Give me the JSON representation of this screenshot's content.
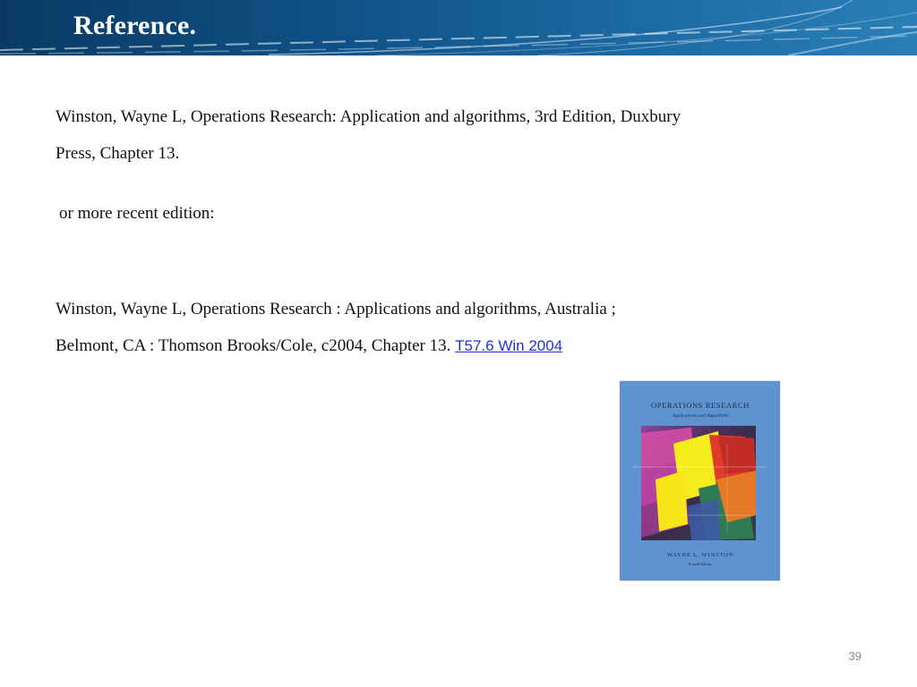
{
  "slide": {
    "title": "Reference.",
    "page_number": "39"
  },
  "references": {
    "ref1_line1": "Winston, Wayne L, Operations Research: Application and algorithms, 3rd Edition, Duxbury",
    "ref1_line2": "Press, Chapter 13.",
    "note": "or more recent edition:",
    "ref2_line1": "Winston, Wayne L,  Operations Research : Applications and algorithms, Australia ;",
    "ref2_line2": "Belmont, CA : Thomson Brooks/Cole, c2004, Chapter 13.",
    "call_number": "T57.6 Win 2004"
  },
  "book_cover": {
    "title": "Operations Research",
    "subtitle": "Applications and Algorithms",
    "author": "Wayne L. Winston",
    "edition": "Fourth Edition"
  },
  "colors": {
    "header_blue": "#0f5288",
    "link_blue": "#1a35d6",
    "cover_blue": "#5e93cf"
  }
}
